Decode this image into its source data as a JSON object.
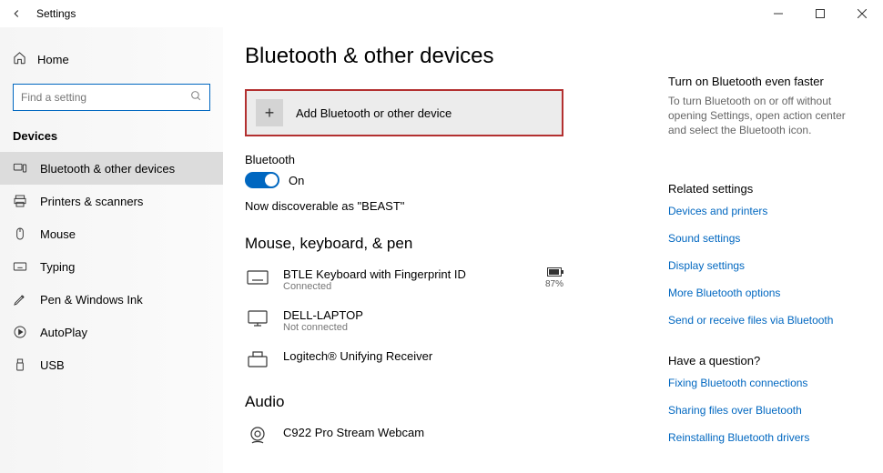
{
  "titlebar": {
    "app": "Settings"
  },
  "sidebar": {
    "home": "Home",
    "search_placeholder": "Find a setting",
    "section": "Devices",
    "items": [
      {
        "label": "Bluetooth & other devices"
      },
      {
        "label": "Printers & scanners"
      },
      {
        "label": "Mouse"
      },
      {
        "label": "Typing"
      },
      {
        "label": "Pen & Windows Ink"
      },
      {
        "label": "AutoPlay"
      },
      {
        "label": "USB"
      }
    ]
  },
  "page": {
    "title": "Bluetooth & other devices",
    "add_device": "Add Bluetooth or other device",
    "bt_label": "Bluetooth",
    "bt_state": "On",
    "discoverable": "Now discoverable as \"BEAST\"",
    "group1": "Mouse, keyboard, & pen",
    "devices1": [
      {
        "name": "BTLE Keyboard with Fingerprint ID",
        "sub": "Connected",
        "battery": "87%"
      },
      {
        "name": "DELL-LAPTOP",
        "sub": "Not connected"
      },
      {
        "name": "Logitech® Unifying Receiver"
      }
    ],
    "group2": "Audio",
    "devices2": [
      {
        "name": "C922 Pro Stream Webcam"
      }
    ]
  },
  "right": {
    "tip_title": "Turn on Bluetooth even faster",
    "tip_body": "To turn Bluetooth on or off without opening Settings, open action center and select the Bluetooth icon.",
    "related_head": "Related settings",
    "related": [
      "Devices and printers",
      "Sound settings",
      "Display settings",
      "More Bluetooth options",
      "Send or receive files via Bluetooth"
    ],
    "help_head": "Have a question?",
    "help": [
      "Fixing Bluetooth connections",
      "Sharing files over Bluetooth",
      "Reinstalling Bluetooth drivers"
    ]
  }
}
